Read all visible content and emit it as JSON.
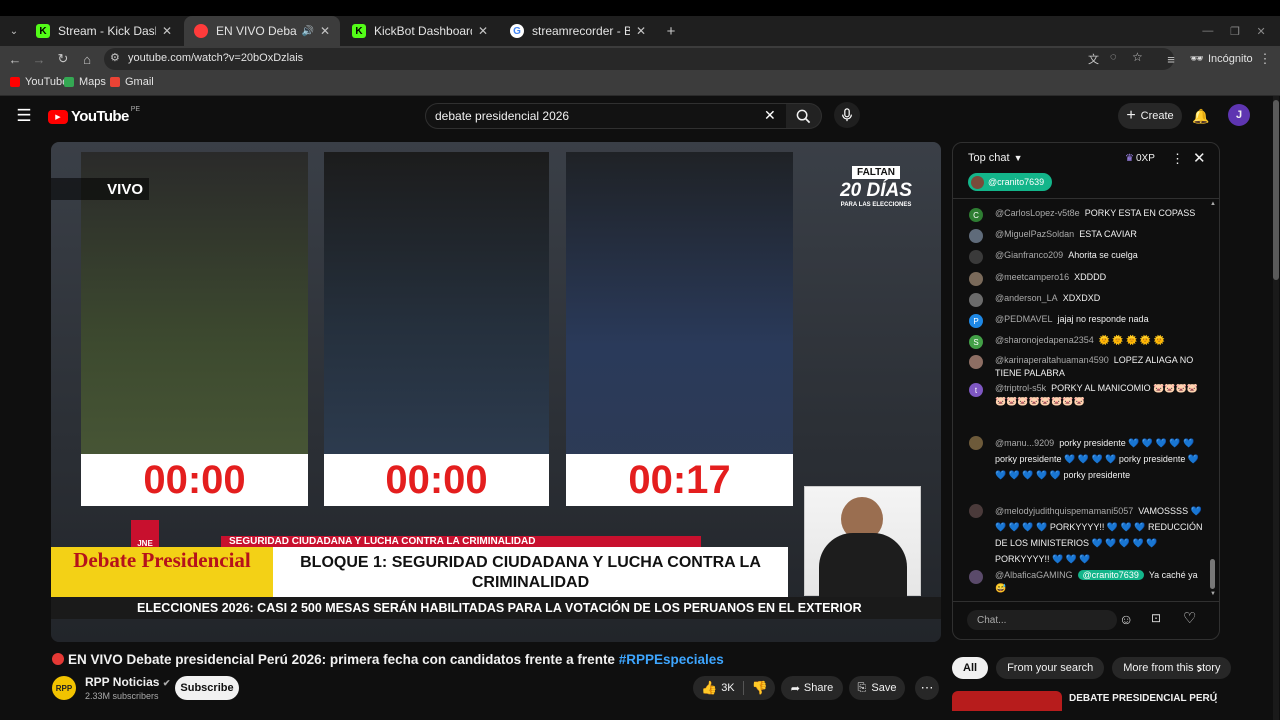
{
  "tabs": [
    {
      "title": "Stream - Kick Dashboard",
      "fav_color": "#53fc18",
      "fav_glyph": "K"
    },
    {
      "title": "EN VIVO Debate preside",
      "fav_color": "#ff0000",
      "fav_glyph": "▶"
    },
    {
      "title": "KickBot Dashboard",
      "fav_color": "#53fc18",
      "fav_glyph": "K"
    },
    {
      "title": "streamrecorder - Buscar con Go",
      "fav_color": "#4285f4",
      "fav_glyph": "G"
    }
  ],
  "browser": {
    "url": "youtube.com/watch?v=20bOxDzlais",
    "incognito_label": "Incógnito",
    "bookmarks": [
      "YouTube",
      "Maps",
      "Gmail"
    ]
  },
  "header": {
    "logo": "YouTube",
    "region": "PE",
    "search_value": "debate presidencial 2026",
    "create_label": "Create",
    "avatar_letter": "J"
  },
  "video": {
    "vivo_label": "VIVO",
    "countdown_top": "FALTAN",
    "countdown_days": "20 DÍAS",
    "countdown_bottom": "PARA LAS ELECCIONES",
    "timers": [
      "00:00",
      "00:00",
      "00:17"
    ],
    "jne": "JNE",
    "subtitle_band": "SEGURIDAD CIUDADANA Y LUCHA CONTRA LA CRIMINALIDAD",
    "debate_title": "Debate Presidencial",
    "bloque": "BLOQUE 1: SEGURIDAD CIUDADANA Y LUCHA CONTRA LA CRIMINALIDAD",
    "ticker": "ELECCIONES 2026: CASI 2 500 MESAS SERÁN HABILITADAS PARA LA VOTACIÓN DE LOS PERUANOS EN EL EXTERIOR"
  },
  "info": {
    "title": "EN VIVO Debate presidencial Perú 2026: primera fecha con candidatos frente a frente",
    "hashtag": "#RPPEspeciales",
    "channel": "RPP Noticias",
    "channel_logo": "RPP",
    "subscribers": "2.33M subscribers",
    "subscribe_label": "Subscribe",
    "likes": "3K",
    "share_label": "Share",
    "save_label": "Save"
  },
  "chat": {
    "mode_label": "Top chat",
    "points": "0XP",
    "pinned_user": "@cranito7639",
    "input_placeholder": "Chat...",
    "messages": [
      {
        "author": "@CarlosLopez-v5t8e",
        "text": "PORKY ESTA EN COPASS",
        "av": "C",
        "color": "#2e7d32"
      },
      {
        "author": "@MiguelPazSoldan",
        "text": "ESTA CAVIAR",
        "av": "",
        "color": "#5f6b7a"
      },
      {
        "author": "@Gianfranco209",
        "text": "Ahorita se cuelga",
        "av": "",
        "color": "#3a3a3a"
      },
      {
        "author": "@meetcampero16",
        "text": "XDDDD",
        "av": "",
        "color": "#7a6a5a"
      },
      {
        "author": "@anderson_LA",
        "text": "XDXDXD",
        "av": "",
        "color": "#6b6b6b"
      },
      {
        "author": "@PEDMAVEL",
        "text": "jajaj no responde nada",
        "av": "P",
        "color": "#1e88e5"
      },
      {
        "author": "@sharonojedapena2354",
        "text": "🌞 🌞 🌞 🌞 🌞",
        "av": "S",
        "color": "#43a047"
      },
      {
        "author": "@karinaperaltahuaman4590",
        "text": "LOPEZ ALIAGA NO TIENE PALABRA",
        "av": "",
        "color": "#8d6e63"
      },
      {
        "author": "@triptrol-s5k",
        "text": "PORKY AL MANICOMIO 🐷🐷🐷🐷🐷🐷🐷🐷🐷🐷🐷🐷",
        "av": "t",
        "color": "#7e57c2"
      },
      {
        "author": "@manu...9209",
        "text": "porky presidente 💙 💙 💙 💙 💙 porky presidente 💙 💙 💙 💙 porky presidente 💙 💙 💙 💙 💙 💙 porky presidente",
        "av": "",
        "color": "#6d5a3a"
      },
      {
        "author": "@melodyjudithquispemamani5057",
        "text": "VAMOSSSS 💙 💙 💙 💙 💙 PORKYYYY!! 💙 💙 💙 REDUCCIÓN DE LOS MINISTERIOS 💙 💙 💙 💙 💙 PORKYYYY!! 💙 💙 💙",
        "av": "",
        "color": "#4a3a3a"
      },
      {
        "author": "@AlbaficaGAMING",
        "text": "Ya caché ya 😅",
        "mention": "@cranito7639",
        "av": "",
        "color": "#5a4a6a"
      }
    ]
  },
  "filters": [
    "All",
    "From your search",
    "More from this story"
  ],
  "rec_title": "DEBATE PRESIDENCIAL PERÚ"
}
